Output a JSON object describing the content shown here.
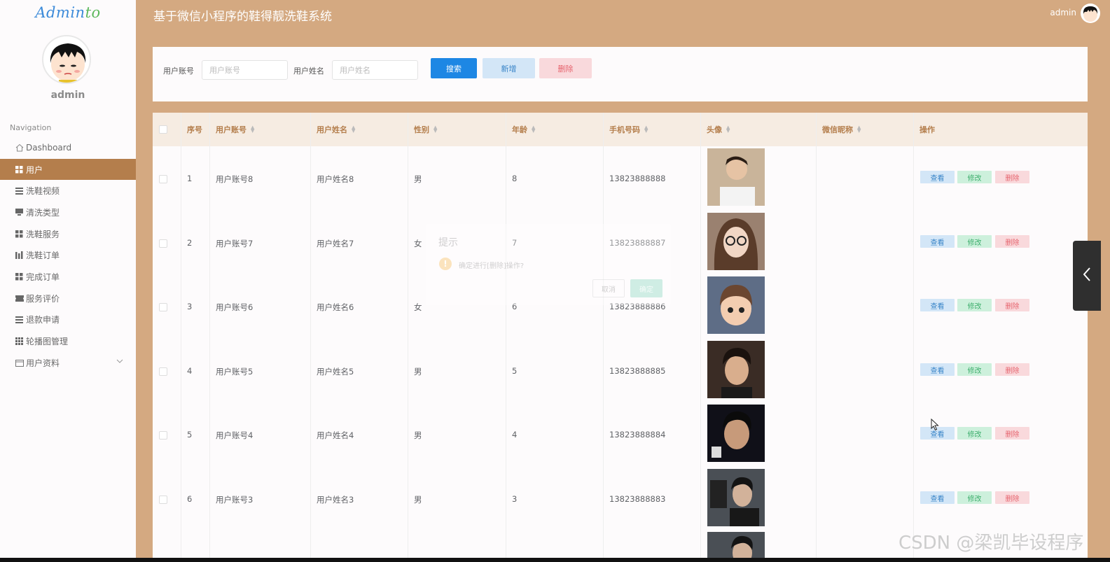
{
  "sidebar": {
    "logo_main": "Admin",
    "logo_accent": "to",
    "username": "admin",
    "nav_title": "Navigation",
    "items": [
      {
        "label": "Dashboard",
        "icon": "home-icon"
      },
      {
        "label": "用户",
        "icon": "grid-icon",
        "active": true
      },
      {
        "label": "洗鞋视频",
        "icon": "list-icon"
      },
      {
        "label": "清洗类型",
        "icon": "monitor-icon"
      },
      {
        "label": "洗鞋服务",
        "icon": "grid-icon"
      },
      {
        "label": "洗鞋订单",
        "icon": "bar-icon"
      },
      {
        "label": "完成订单",
        "icon": "grid-icon"
      },
      {
        "label": "服务评价",
        "icon": "ticket-icon"
      },
      {
        "label": "退款申请",
        "icon": "list-icon"
      },
      {
        "label": "轮播图管理",
        "icon": "apps-icon"
      },
      {
        "label": "用户资料",
        "icon": "calendar-icon",
        "expandable": true
      }
    ]
  },
  "header": {
    "title": "基于微信小程序的鞋得靓洗鞋系统",
    "user": "admin"
  },
  "search": {
    "account_label": "用户账号",
    "account_placeholder": "用户账号",
    "name_label": "用户姓名",
    "name_placeholder": "用户姓名",
    "search_btn": "搜索",
    "add_btn": "新增",
    "delete_btn": "删除"
  },
  "table": {
    "columns": [
      "序号",
      "用户账号",
      "用户姓名",
      "性别",
      "年龄",
      "手机号码",
      "头像",
      "微信昵称",
      "操作"
    ],
    "rows": [
      {
        "no": "1",
        "account": "用户账号8",
        "name": "用户姓名8",
        "gender": "男",
        "age": "8",
        "phone": "13823888888",
        "nickname": ""
      },
      {
        "no": "2",
        "account": "用户账号7",
        "name": "用户姓名7",
        "gender": "女",
        "age": "7",
        "phone": "13823888887",
        "nickname": ""
      },
      {
        "no": "3",
        "account": "用户账号6",
        "name": "用户姓名6",
        "gender": "女",
        "age": "6",
        "phone": "13823888886",
        "nickname": ""
      },
      {
        "no": "4",
        "account": "用户账号5",
        "name": "用户姓名5",
        "gender": "男",
        "age": "5",
        "phone": "13823888885",
        "nickname": ""
      },
      {
        "no": "5",
        "account": "用户账号4",
        "name": "用户姓名4",
        "gender": "男",
        "age": "4",
        "phone": "13823888884",
        "nickname": ""
      },
      {
        "no": "6",
        "account": "用户账号3",
        "name": "用户姓名3",
        "gender": "男",
        "age": "3",
        "phone": "13823888883",
        "nickname": ""
      }
    ],
    "op_view": "查看",
    "op_edit": "修改",
    "op_delete": "删除"
  },
  "dialog": {
    "title": "提示",
    "message": "确定进行[删除]操作?",
    "cancel": "取消",
    "confirm": "确定"
  },
  "watermark": "CSDN @梁凯毕设程序",
  "colors": {
    "header_bg": "#d4a981",
    "active_menu": "#b47e4c",
    "primary": "#1d87e4",
    "table_head_bg": "#f6ece2"
  }
}
